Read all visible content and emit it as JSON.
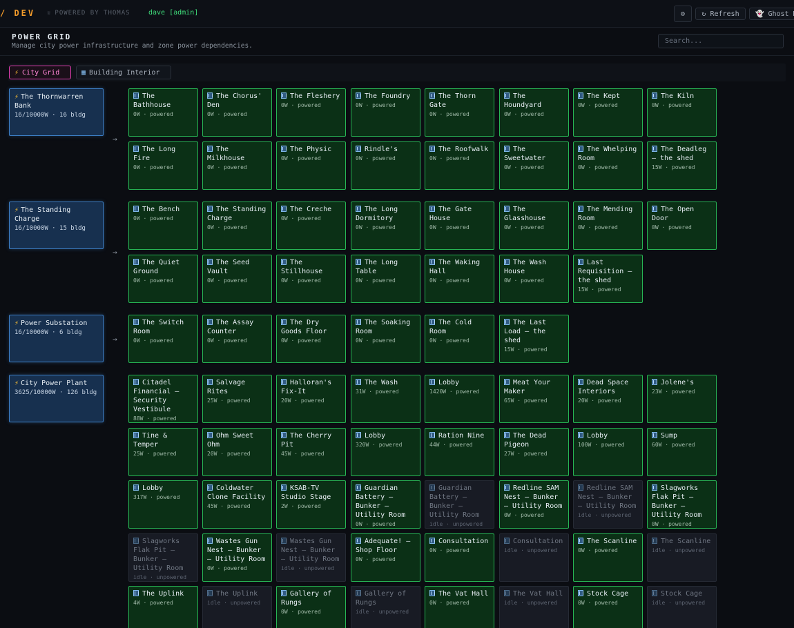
{
  "app": {
    "logo": "/ DEV",
    "powered_by": "POWERED BY THOMAS",
    "user": "dave [admin]"
  },
  "toolbar": {
    "settings_icon": "gear-icon",
    "refresh_label": "↻ Refresh",
    "ghost_label": "👻 Ghost M"
  },
  "header": {
    "title": "POWER GRID",
    "subtitle": "Manage city power infrastructure and zone power dependencies.",
    "search_placeholder": "Search..."
  },
  "tabs": [
    {
      "label": "City Grid",
      "icon": "bolt-icon",
      "active": true
    },
    {
      "label": "Building Interior",
      "icon": "building-icon",
      "active": false
    }
  ],
  "colors": {
    "accent_pink": "#e33fb2",
    "powered_green": "#27b554",
    "source_blue": "#3d7fc6",
    "logo_orange": "#f39c2b"
  },
  "groups": [
    {
      "source": {
        "name": "The Thornwarren Bank",
        "stats": "16/10000W · 16 bldg"
      },
      "buildings": [
        {
          "name": "The Bathhouse",
          "status": "0W · powered",
          "powered": true
        },
        {
          "name": "The Chorus' Den",
          "status": "0W · powered",
          "powered": true
        },
        {
          "name": "The Fleshery",
          "status": "0W · powered",
          "powered": true
        },
        {
          "name": "The Foundry",
          "status": "0W · powered",
          "powered": true
        },
        {
          "name": "The Thorn Gate",
          "status": "0W · powered",
          "powered": true
        },
        {
          "name": "The Houndyard",
          "status": "0W · powered",
          "powered": true
        },
        {
          "name": "The Kept",
          "status": "0W · powered",
          "powered": true
        },
        {
          "name": "The Kiln",
          "status": "0W · powered",
          "powered": true
        },
        {
          "name": "The Long Fire",
          "status": "0W · powered",
          "powered": true
        },
        {
          "name": "The Milkhouse",
          "status": "0W · powered",
          "powered": true
        },
        {
          "name": "The Physic",
          "status": "0W · powered",
          "powered": true
        },
        {
          "name": "Rindle's",
          "status": "0W · powered",
          "powered": true
        },
        {
          "name": "The Roofwalk",
          "status": "0W · powered",
          "powered": true
        },
        {
          "name": "The Sweetwater",
          "status": "0W · powered",
          "powered": true
        },
        {
          "name": "The Whelping Room",
          "status": "0W · powered",
          "powered": true
        },
        {
          "name": "The Deadleg — the shed",
          "status": "15W · powered",
          "powered": true
        }
      ]
    },
    {
      "source": {
        "name": "The Standing Charge",
        "stats": "16/10000W · 15 bldg"
      },
      "buildings": [
        {
          "name": "The Bench",
          "status": "0W · powered",
          "powered": true
        },
        {
          "name": "The Standing Charge",
          "status": "0W · powered",
          "powered": true
        },
        {
          "name": "The Creche",
          "status": "0W · powered",
          "powered": true
        },
        {
          "name": "The Long Dormitory",
          "status": "0W · powered",
          "powered": true
        },
        {
          "name": "The Gate House",
          "status": "0W · powered",
          "powered": true
        },
        {
          "name": "The Glasshouse",
          "status": "0W · powered",
          "powered": true
        },
        {
          "name": "The Mending Room",
          "status": "0W · powered",
          "powered": true
        },
        {
          "name": "The Open Door",
          "status": "0W · powered",
          "powered": true
        },
        {
          "name": "The Quiet Ground",
          "status": "0W · powered",
          "powered": true
        },
        {
          "name": "The Seed Vault",
          "status": "0W · powered",
          "powered": true
        },
        {
          "name": "The Stillhouse",
          "status": "0W · powered",
          "powered": true
        },
        {
          "name": "The Long Table",
          "status": "0W · powered",
          "powered": true
        },
        {
          "name": "The Waking Hall",
          "status": "0W · powered",
          "powered": true
        },
        {
          "name": "The Wash House",
          "status": "0W · powered",
          "powered": true
        },
        {
          "name": "Last Requisition — the shed",
          "status": "15W · powered",
          "powered": true
        }
      ]
    },
    {
      "source": {
        "name": "Power Substation",
        "stats": "16/10000W · 6 bldg"
      },
      "buildings": [
        {
          "name": "The Switch Room",
          "status": "0W · powered",
          "powered": true
        },
        {
          "name": "The Assay Counter",
          "status": "0W · powered",
          "powered": true
        },
        {
          "name": "The Dry Goods Floor",
          "status": "0W · powered",
          "powered": true
        },
        {
          "name": "The Soaking Room",
          "status": "0W · powered",
          "powered": true
        },
        {
          "name": "The Cold Room",
          "status": "0W · powered",
          "powered": true
        },
        {
          "name": "The Last Load — the shed",
          "status": "15W · powered",
          "powered": true
        }
      ]
    },
    {
      "source": {
        "name": "City Power Plant",
        "stats": "3625/10000W · 126 bldg"
      },
      "buildings": [
        {
          "name": "Citadel Financial — Security Vestibule",
          "status": "88W · powered",
          "powered": true
        },
        {
          "name": "Salvage Rites",
          "status": "25W · powered",
          "powered": true
        },
        {
          "name": "Halloran's Fix-It",
          "status": "20W · powered",
          "powered": true
        },
        {
          "name": "The Wash",
          "status": "31W · powered",
          "powered": true
        },
        {
          "name": "Lobby",
          "status": "1420W · powered",
          "powered": true
        },
        {
          "name": "Meat Your Maker",
          "status": "65W · powered",
          "powered": true
        },
        {
          "name": "Dead Space Interiors",
          "status": "20W · powered",
          "powered": true
        },
        {
          "name": "Jolene's",
          "status": "23W · powered",
          "powered": true
        },
        {
          "name": "Tine & Temper",
          "status": "25W · powered",
          "powered": true
        },
        {
          "name": "Ohm Sweet Ohm",
          "status": "20W · powered",
          "powered": true
        },
        {
          "name": "The Cherry Pit",
          "status": "45W · powered",
          "powered": true
        },
        {
          "name": "Lobby",
          "status": "320W · powered",
          "powered": true
        },
        {
          "name": "Ration Nine",
          "status": "44W · powered",
          "powered": true
        },
        {
          "name": "The Dead Pigeon",
          "status": "27W · powered",
          "powered": true
        },
        {
          "name": "Lobby",
          "status": "100W · powered",
          "powered": true
        },
        {
          "name": "Sump",
          "status": "60W · powered",
          "powered": true
        },
        {
          "name": "Lobby",
          "status": "317W · powered",
          "powered": true
        },
        {
          "name": "Coldwater Clone Facility",
          "status": "45W · powered",
          "powered": true
        },
        {
          "name": "KSAB-TV Studio Stage",
          "status": "2W · powered",
          "powered": true
        },
        {
          "name": "Guardian Battery — Bunker — Utility Room",
          "status": "0W · powered",
          "powered": true
        },
        {
          "name": "Guardian Battery — Bunker — Utility Room",
          "status": "idle · unpowered",
          "powered": false
        },
        {
          "name": "Redline SAM Nest — Bunker — Utility Room",
          "status": "0W · powered",
          "powered": true
        },
        {
          "name": "Redline SAM Nest — Bunker — Utility Room",
          "status": "idle · unpowered",
          "powered": false
        },
        {
          "name": "Slagworks Flak Pit — Bunker — Utility Room",
          "status": "0W · powered",
          "powered": true
        },
        {
          "name": "Slagworks Flak Pit — Bunker — Utility Room",
          "status": "idle · unpowered",
          "powered": false
        },
        {
          "name": "Wastes Gun Nest — Bunker — Utility Room",
          "status": "0W · powered",
          "powered": true
        },
        {
          "name": "Wastes Gun Nest — Bunker — Utility Room",
          "status": "idle · unpowered",
          "powered": false
        },
        {
          "name": "Adequate! — Shop Floor",
          "status": "0W · powered",
          "powered": true
        },
        {
          "name": "Consultation",
          "status": "0W · powered",
          "powered": true
        },
        {
          "name": "Consultation",
          "status": "idle · unpowered",
          "powered": false
        },
        {
          "name": "The Scanline",
          "status": "0W · powered",
          "powered": true
        },
        {
          "name": "The Scanline",
          "status": "idle · unpowered",
          "powered": false
        },
        {
          "name": "The Uplink",
          "status": "4W · powered",
          "powered": true
        },
        {
          "name": "The Uplink",
          "status": "idle · unpowered",
          "powered": false
        },
        {
          "name": "Gallery of Rungs",
          "status": "0W · powered",
          "powered": true
        },
        {
          "name": "Gallery of Rungs",
          "status": "idle · unpowered",
          "powered": false
        },
        {
          "name": "The Vat Hall",
          "status": "0W · powered",
          "powered": true
        },
        {
          "name": "The Vat Hall",
          "status": "idle · unpowered",
          "powered": false
        },
        {
          "name": "Stock Cage",
          "status": "0W · powered",
          "powered": true
        },
        {
          "name": "Stock Cage",
          "status": "idle · unpowered",
          "powered": false
        }
      ]
    }
  ]
}
